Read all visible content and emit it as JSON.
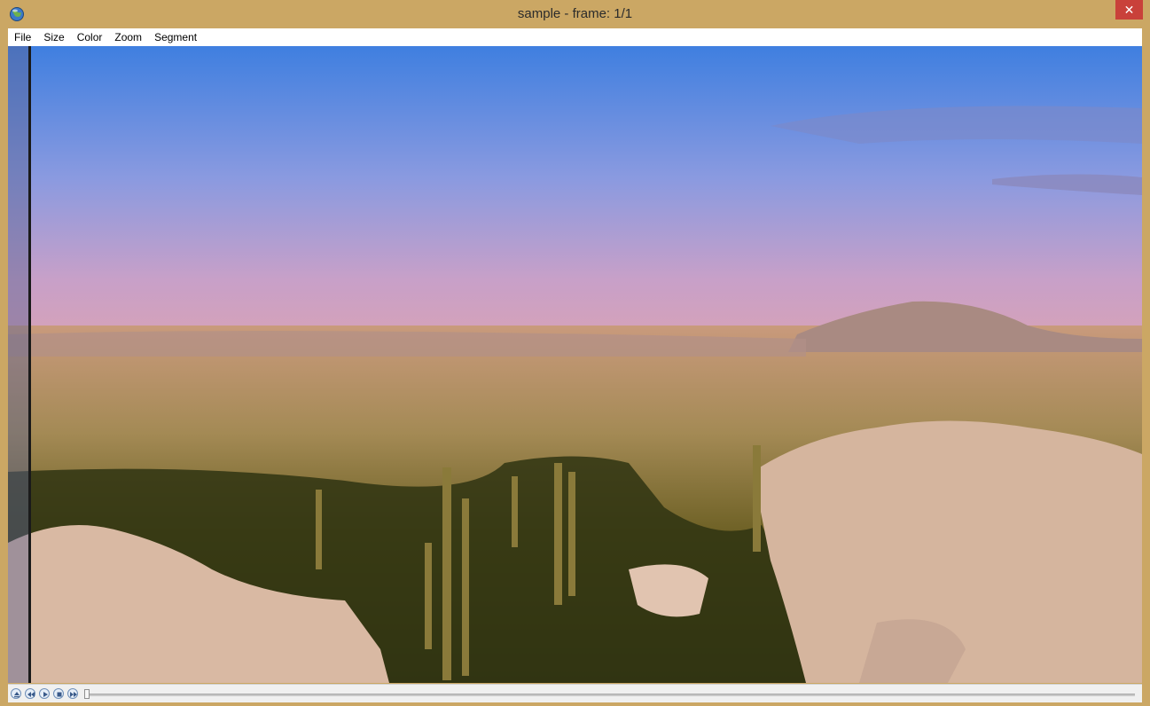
{
  "window": {
    "title": "sample - frame: 1/1",
    "close_symbol": "✕"
  },
  "menu": [
    "File",
    "Size",
    "Color",
    "Zoom",
    "Segment"
  ],
  "icons": {
    "app": "globe-icon",
    "eject": "eject-icon",
    "rewind": "rewind-icon",
    "play": "play-icon",
    "stop": "stop-icon",
    "fast_forward": "fast-forward-icon"
  },
  "playback": {
    "frame_current": 1,
    "frame_total": 1,
    "slider_position_fraction": 0.0
  },
  "colors": {
    "frame": "#cba764",
    "close": "#c9413a",
    "sky_top": "#3f7fe0",
    "sky_bottom": "#d6a2b8",
    "ground": "#7b6b2a"
  }
}
